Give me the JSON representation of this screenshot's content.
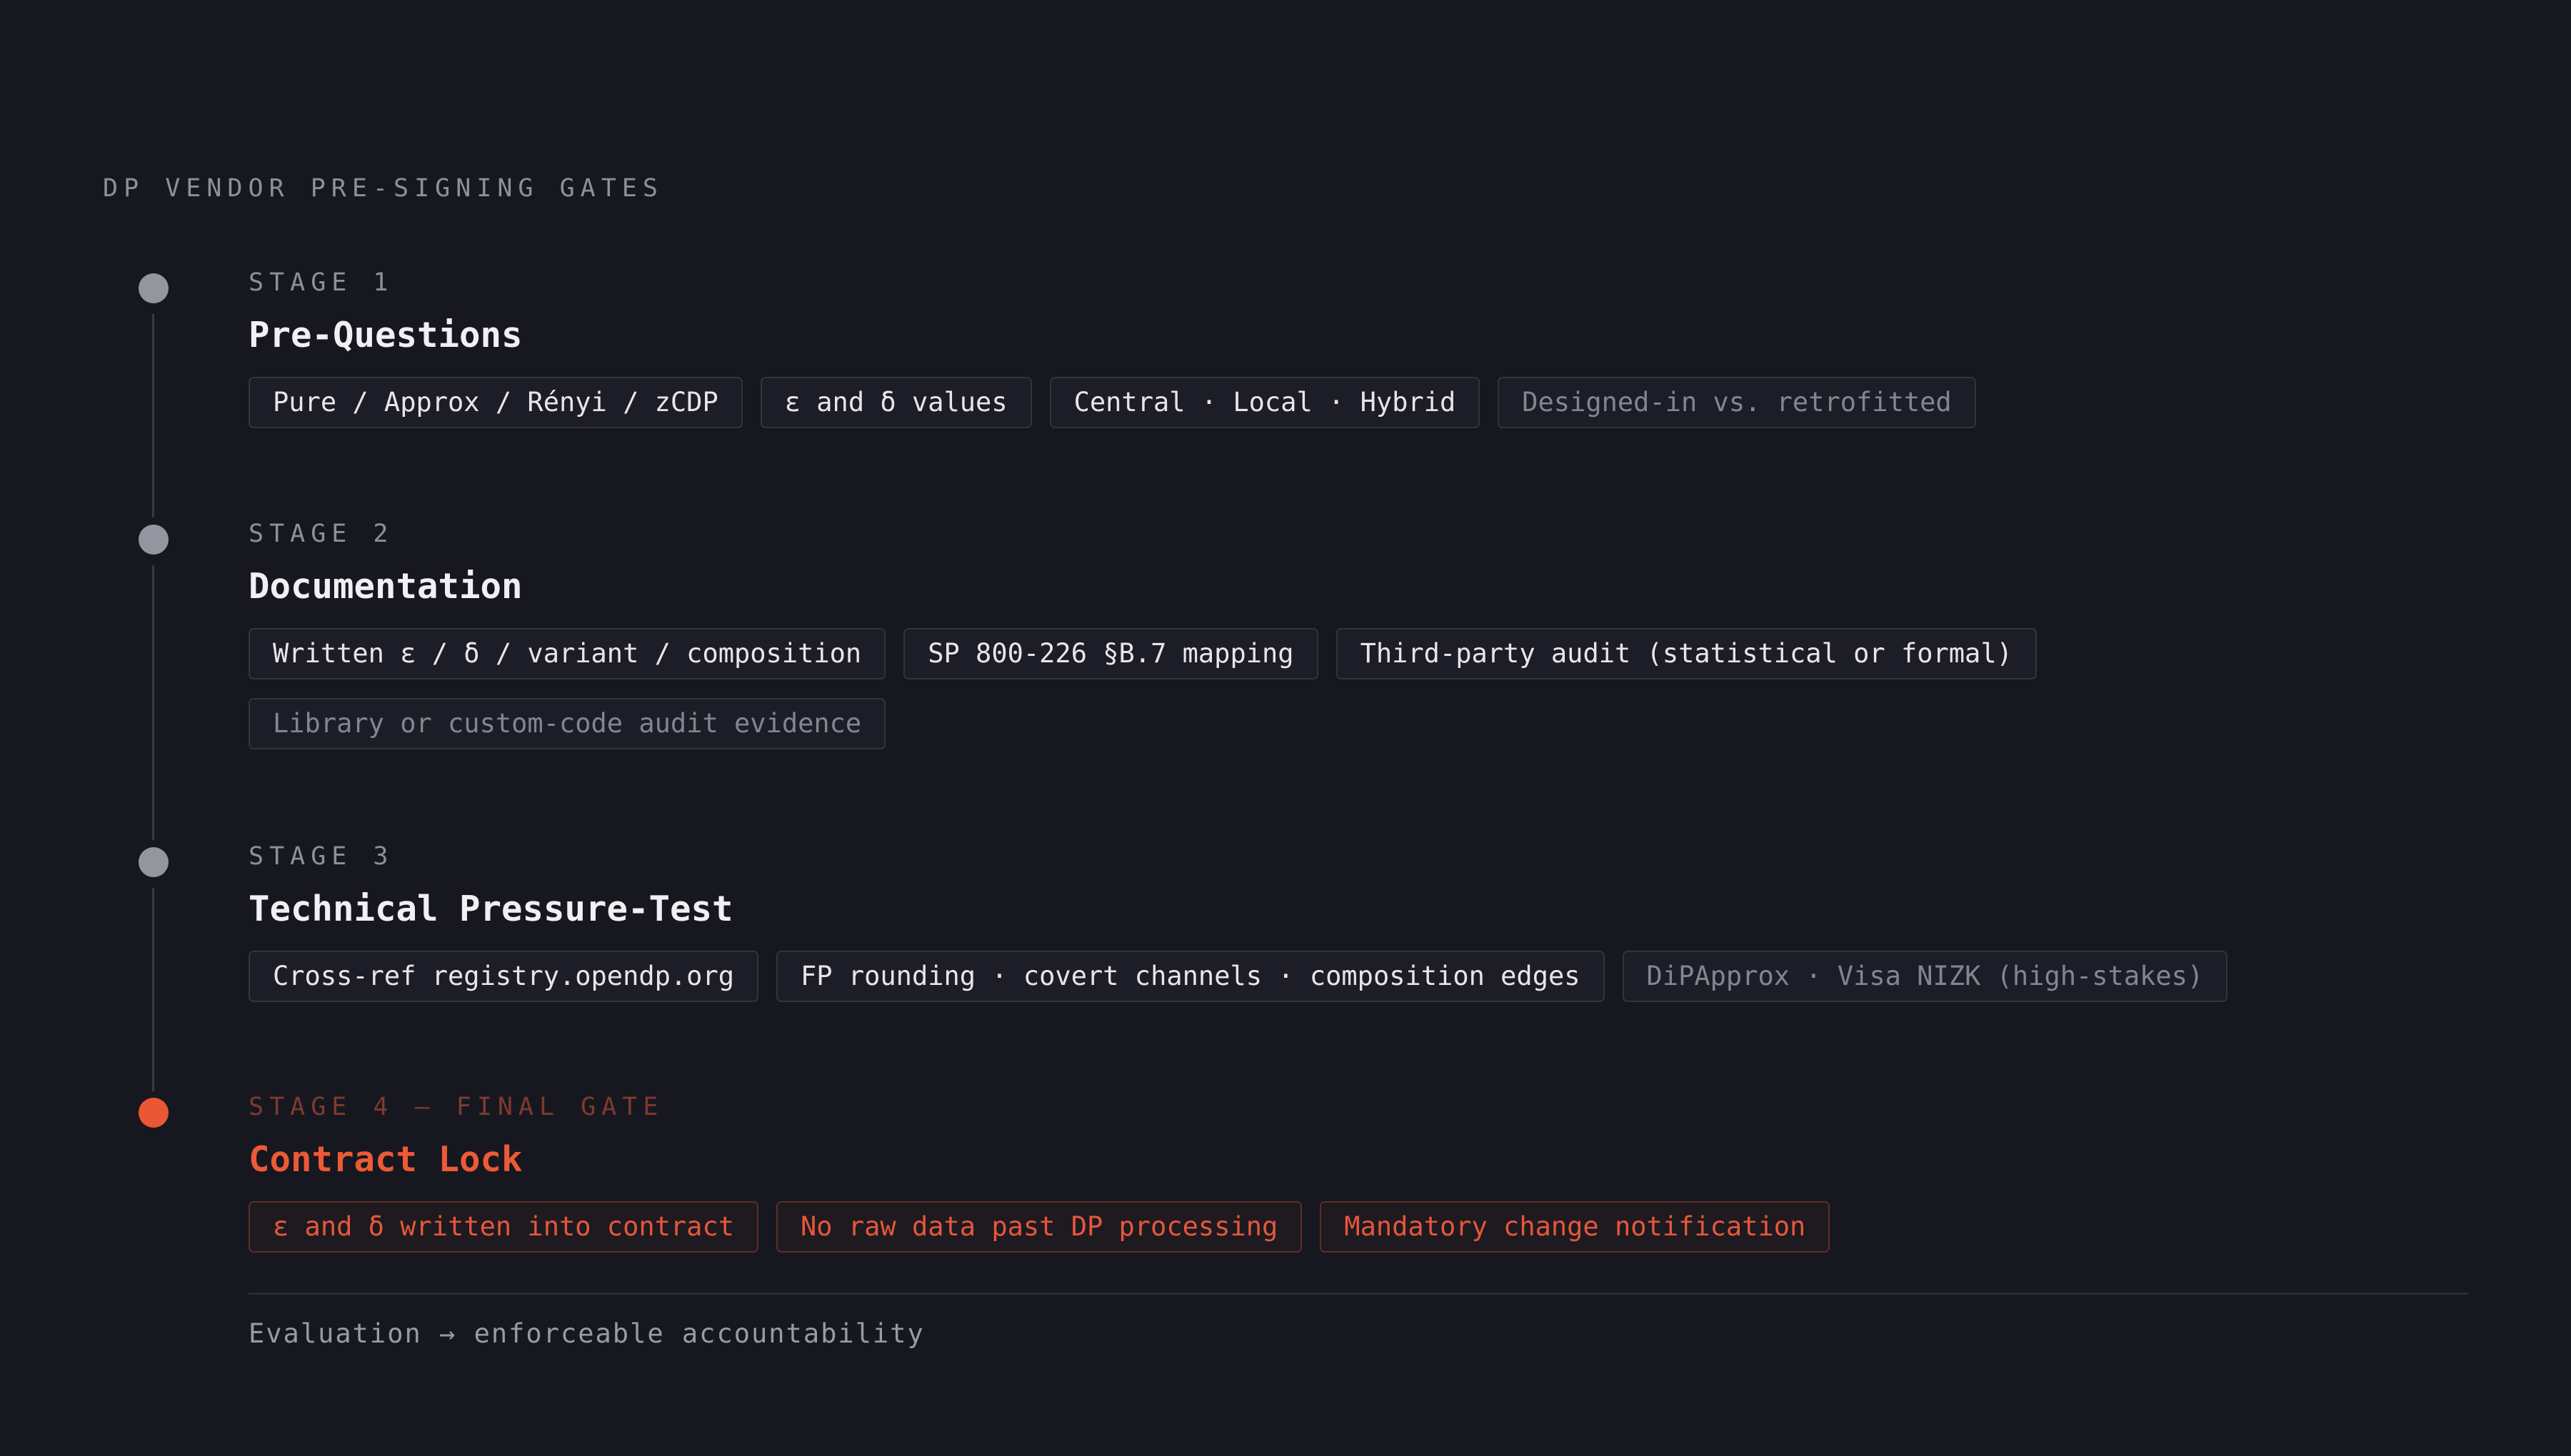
{
  "title": "DP VENDOR PRE-SIGNING GATES",
  "colors": {
    "background": "#171720",
    "accent": "#ea5734",
    "dot": "#95959f",
    "muted_text": "#8f8f99"
  },
  "stages": [
    {
      "label": "STAGE 1",
      "title": "Pre-Questions",
      "chips": [
        {
          "text": "Pure / Approx / Rényi / zCDP",
          "style": "normal"
        },
        {
          "text": "ε and δ values",
          "style": "normal"
        },
        {
          "text": "Central · Local · Hybrid",
          "style": "normal"
        },
        {
          "text": "Designed-in vs. retrofitted",
          "style": "muted"
        }
      ]
    },
    {
      "label": "STAGE 2",
      "title": "Documentation",
      "chips": [
        {
          "text": "Written ε / δ / variant / composition",
          "style": "normal"
        },
        {
          "text": "SP 800-226 §B.7 mapping",
          "style": "normal"
        },
        {
          "text": "Third-party audit (statistical or formal)",
          "style": "normal"
        },
        {
          "text": "Library or custom-code audit evidence",
          "style": "muted"
        }
      ]
    },
    {
      "label": "STAGE 3",
      "title": "Technical Pressure-Test",
      "chips": [
        {
          "text": "Cross-ref registry.opendp.org",
          "style": "normal"
        },
        {
          "text": "FP rounding · covert channels · composition edges",
          "style": "normal"
        },
        {
          "text": "DiPApprox · Visa NIZK (high-stakes)",
          "style": "muted"
        }
      ]
    },
    {
      "label": "STAGE 4 — FINAL GATE",
      "title": "Contract Lock",
      "chips": [
        {
          "text": "ε and δ written into contract",
          "style": "accent"
        },
        {
          "text": "No raw data past DP processing",
          "style": "accent"
        },
        {
          "text": "Mandatory change notification",
          "style": "accent"
        }
      ]
    }
  ],
  "footer": "Evaluation → enforceable accountability"
}
